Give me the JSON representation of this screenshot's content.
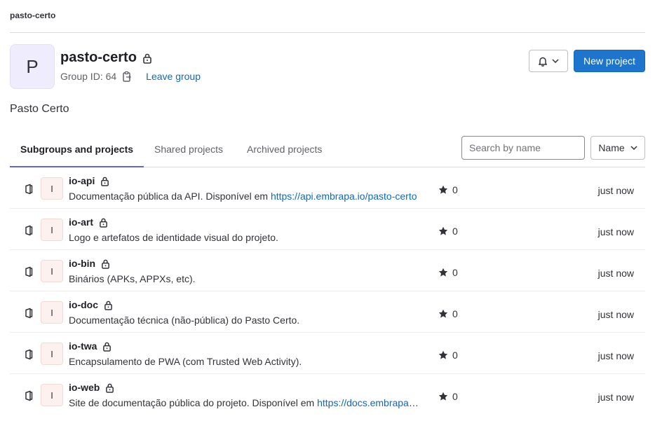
{
  "breadcrumb": "pasto-certo",
  "group": {
    "avatar_letter": "P",
    "name": "pasto-certo",
    "id_label": "Group ID: 64",
    "leave_label": "Leave group",
    "description": "Pasto Certo"
  },
  "header_actions": {
    "notifications_icon": "bell-icon",
    "new_project_label": "New project"
  },
  "tabs": [
    {
      "label": "Subgroups and projects",
      "active": true
    },
    {
      "label": "Shared projects",
      "active": false
    },
    {
      "label": "Archived projects",
      "active": false
    }
  ],
  "search": {
    "placeholder": "Search by name",
    "value": ""
  },
  "sort": {
    "label": "Name"
  },
  "colors": {
    "primary": "#1f75cb",
    "link": "#1068bf",
    "tab_indicator": "#6666c4",
    "group_avatar_bg": "#eeecfd",
    "project_avatar_bg": "#fcf1ef"
  },
  "projects": [
    {
      "avatar_letter": "I",
      "name": "io-api",
      "description": "Documentação pública da API. Disponível em ",
      "link": "https://api.embrapa.io/pasto-certo",
      "stars": "0",
      "updated": "just now"
    },
    {
      "avatar_letter": "I",
      "name": "io-art",
      "description": "Logo e artefatos de identidade visual do projeto.",
      "link": "",
      "stars": "0",
      "updated": "just now"
    },
    {
      "avatar_letter": "I",
      "name": "io-bin",
      "description": "Binários (APKs, APPXs, etc).",
      "link": "",
      "stars": "0",
      "updated": "just now"
    },
    {
      "avatar_letter": "I",
      "name": "io-doc",
      "description": "Documentação técnica (não-pública) do Pasto Certo.",
      "link": "",
      "stars": "0",
      "updated": "just now"
    },
    {
      "avatar_letter": "I",
      "name": "io-twa",
      "description": "Encapsulamento de PWA (com Trusted Web Activity).",
      "link": "",
      "stars": "0",
      "updated": "just now"
    },
    {
      "avatar_letter": "I",
      "name": "io-web",
      "description": "Site de documentação pública do projeto. Disponível em ",
      "link": "https://docs.embrapa.io/pasto-certo",
      "stars": "0",
      "updated": "just now"
    }
  ]
}
